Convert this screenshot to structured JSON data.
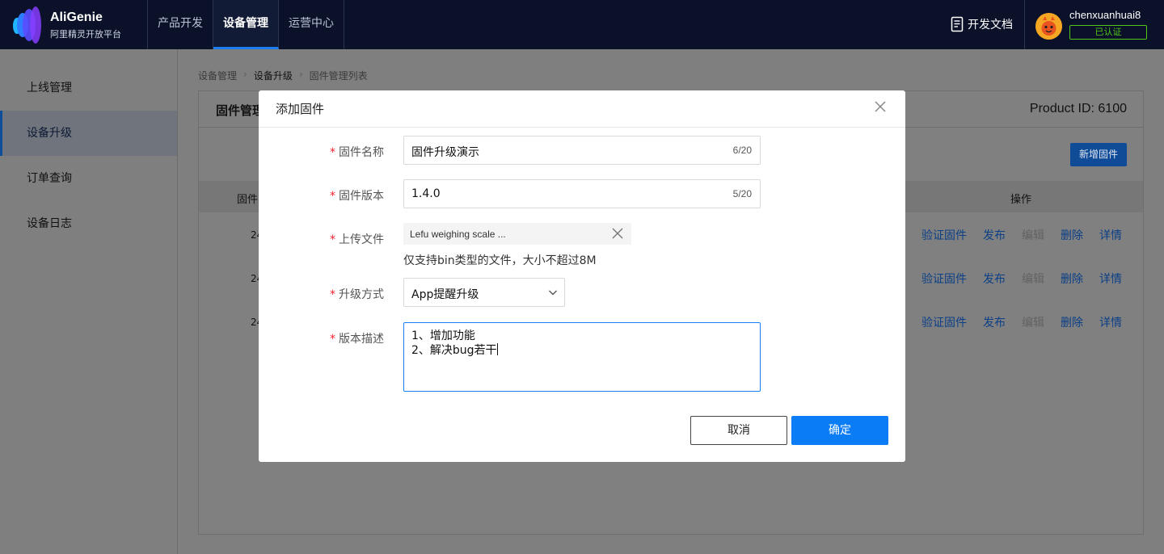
{
  "colors": {
    "topbar_bg": "#0a1128",
    "accent": "#0a7cf5",
    "required": "#f5222d",
    "verified": "#52c41a",
    "overlay_link": "#0b3f86"
  },
  "brand": {
    "name": "AliGenie",
    "subtitle": "阿里精灵开放平台",
    "logo_icon": "aligenie-logo-icon"
  },
  "topnav": {
    "items": [
      {
        "label": "产品开发",
        "active": false
      },
      {
        "label": "设备管理",
        "active": true
      },
      {
        "label": "运营中心",
        "active": false
      }
    ]
  },
  "header": {
    "dev_docs_label": "开发文档",
    "dev_docs_icon": "document-icon",
    "username": "chenxuanhuai8",
    "verified_badge": "已认证",
    "avatar_icon": "user-avatar"
  },
  "sidebar": {
    "items": [
      {
        "label": "上线管理",
        "active": false
      },
      {
        "label": "设备升级",
        "active": true
      },
      {
        "label": "订单查询",
        "active": false
      },
      {
        "label": "设备日志",
        "active": false
      }
    ]
  },
  "breadcrumb": {
    "items": [
      "设备管理",
      "设备升级",
      "固件管理列表"
    ]
  },
  "panel": {
    "title": "固件管理",
    "product_id": "Product ID: 6100",
    "add_button": "新增固件",
    "table": {
      "col_firmware": "固件",
      "col_ops": "操作",
      "rows": [
        {
          "cell": "24",
          "ops": [
            "验证固件",
            "发布",
            "编辑",
            "删除",
            "详情"
          ]
        },
        {
          "cell": "24",
          "ops": [
            "验证固件",
            "发布",
            "编辑",
            "删除",
            "详情"
          ]
        },
        {
          "cell": "24",
          "ops": [
            "验证固件",
            "发布",
            "编辑",
            "删除",
            "详情"
          ]
        }
      ],
      "disabled_op": "编辑"
    }
  },
  "modal": {
    "title": "添加固件",
    "close_icon": "close-icon",
    "required_mark": "*",
    "fields": {
      "name": {
        "label": "固件名称",
        "value": "固件升级演示",
        "count": "6/20"
      },
      "version": {
        "label": "固件版本",
        "value": "1.4.0",
        "count": "5/20"
      },
      "upload": {
        "label": "上传文件",
        "file_name": "Lefu weighing scale ...",
        "hint": "仅支持bin类型的文件，大小不超过8M"
      },
      "method": {
        "label": "升级方式",
        "value": "App提醒升级"
      },
      "description": {
        "label": "版本描述",
        "lines": [
          "1、增加功能",
          "2、解决bug若干"
        ]
      }
    },
    "cancel_label": "取消",
    "confirm_label": "确定"
  }
}
